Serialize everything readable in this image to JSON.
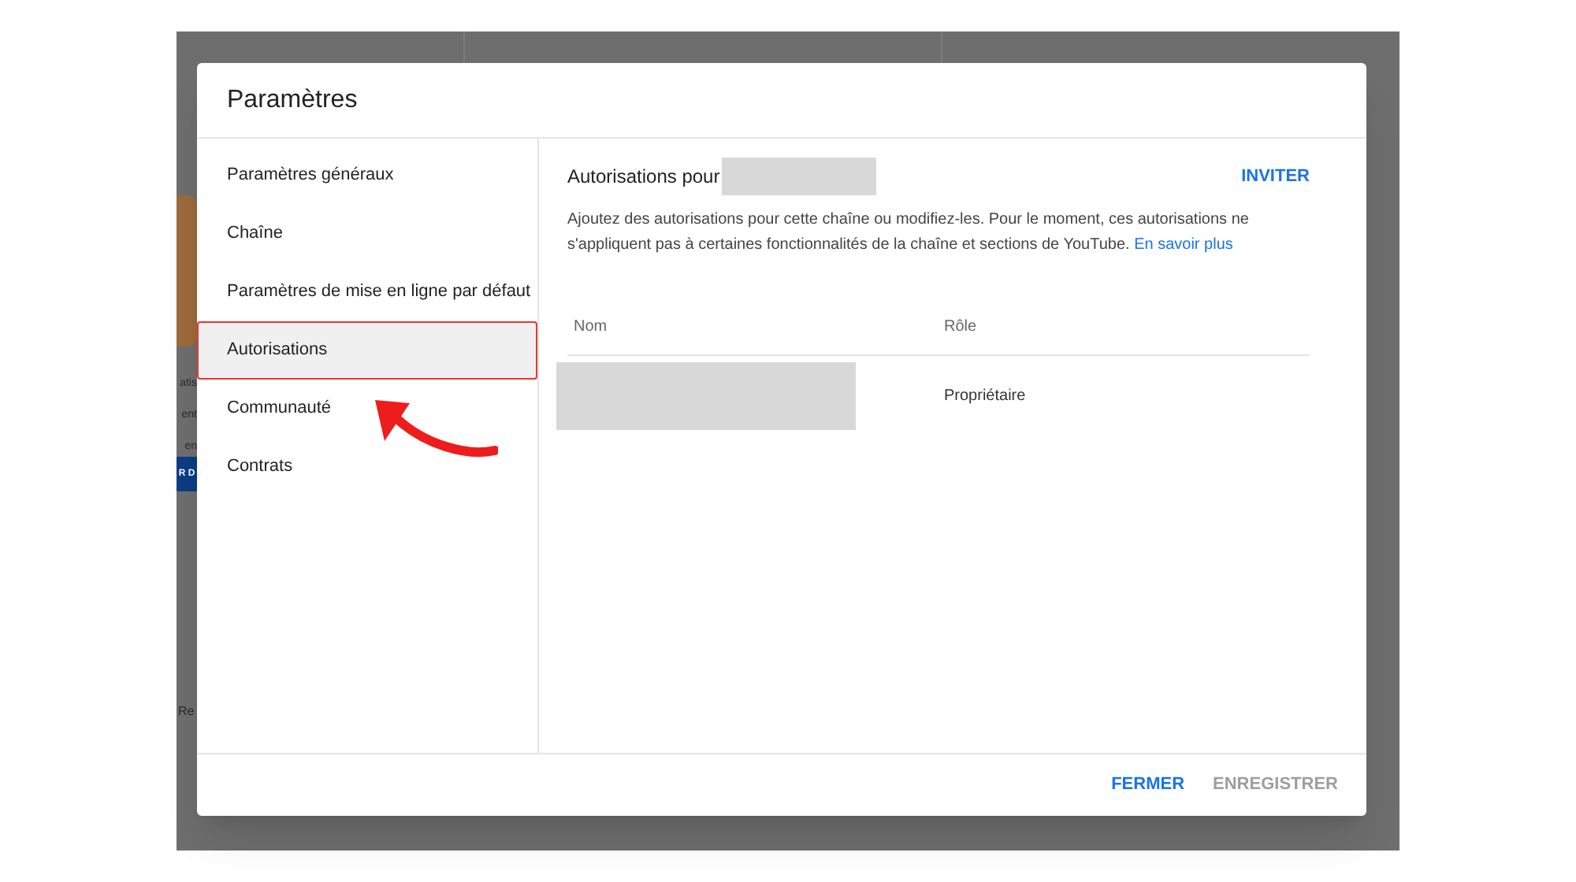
{
  "backdrop": {
    "fragments": [
      "atis",
      "ent",
      "en"
    ],
    "button": "R D",
    "footer_fragment": "Re"
  },
  "dialog": {
    "title": "Paramètres",
    "sidebar": {
      "items": [
        {
          "label": "Paramètres généraux",
          "selected": false
        },
        {
          "label": "Chaîne",
          "selected": false
        },
        {
          "label": "Paramètres de mise en ligne par défaut",
          "selected": false
        },
        {
          "label": "Autorisations",
          "selected": true
        },
        {
          "label": "Communauté",
          "selected": false
        },
        {
          "label": "Contrats",
          "selected": false
        }
      ]
    },
    "content": {
      "title": "Autorisations pour",
      "invite_button": "INVITER",
      "description": "Ajoutez des autorisations pour cette chaîne ou modifiez-les. Pour le moment, ces autorisations ne s'appliquent pas à certaines fonctionnalités de la chaîne et sections de YouTube.",
      "learn_more_link": "En savoir plus",
      "table": {
        "columns": [
          "Nom",
          "Rôle"
        ],
        "rows": [
          {
            "role": "Propriétaire"
          }
        ]
      }
    },
    "footer": {
      "buttons": [
        {
          "label": "FERMER",
          "disabled": false
        },
        {
          "label": "ENREGISTRER",
          "disabled": true
        }
      ]
    }
  }
}
